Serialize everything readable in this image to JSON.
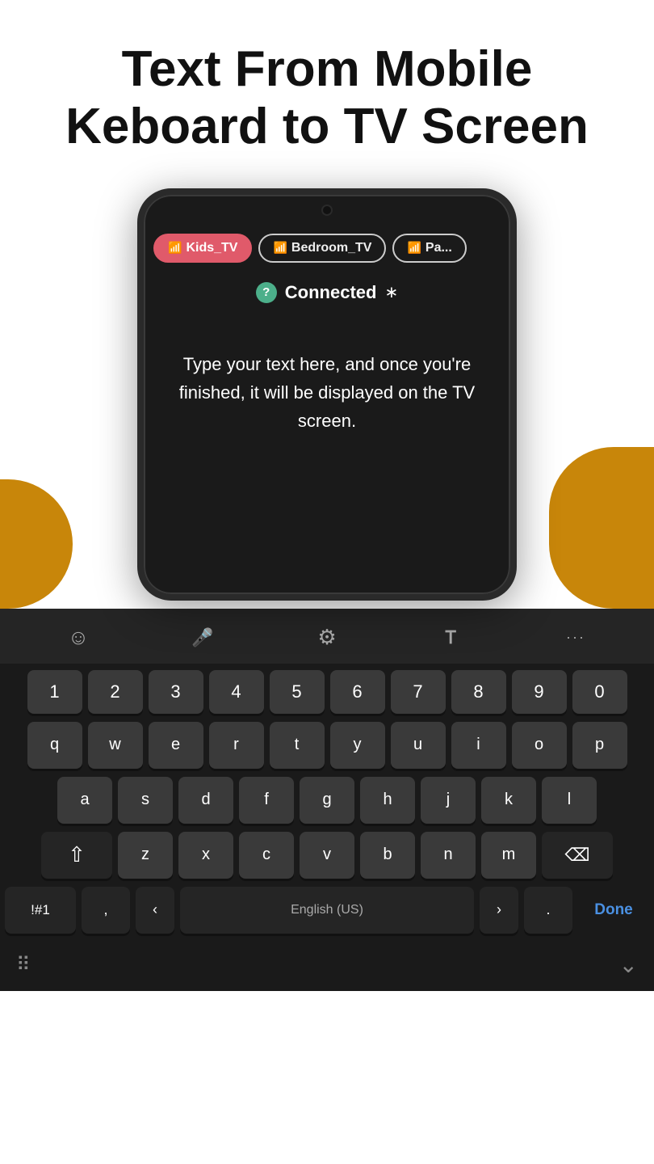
{
  "header": {
    "title": "Text From Mobile Keboard to TV Screen"
  },
  "phone": {
    "tabs": [
      {
        "label": "Kids_TV",
        "active": true
      },
      {
        "label": "Bedroom_TV",
        "active": false
      },
      {
        "label": "Pa...",
        "active": false
      }
    ],
    "status": {
      "connected_label": "Connected",
      "icon_label": "?"
    },
    "typing_placeholder": "Type your text here, and once you're finished, it will be displayed on the TV screen."
  },
  "keyboard": {
    "toolbar": {
      "emoji_icon": "☺",
      "mic_icon": "🎤",
      "settings_icon": "⚙",
      "font_icon": "Ꭲ",
      "more_icon": "···"
    },
    "rows": {
      "numbers": [
        "1",
        "2",
        "3",
        "4",
        "5",
        "6",
        "7",
        "8",
        "9",
        "0"
      ],
      "row1": [
        "q",
        "w",
        "e",
        "r",
        "t",
        "y",
        "u",
        "i",
        "o",
        "p"
      ],
      "row2": [
        "a",
        "s",
        "d",
        "f",
        "g",
        "h",
        "j",
        "k",
        "l"
      ],
      "row3": [
        "z",
        "x",
        "c",
        "v",
        "b",
        "n",
        "m"
      ],
      "bottom": {
        "symbols": "!#1",
        "comma": ",",
        "left_arrow": "‹",
        "space": "English (US)",
        "right_arrow": "›",
        "period": ".",
        "done": "Done"
      }
    },
    "bottom_bar": {
      "switcher_icon": "⠿",
      "hide_icon": "⌄"
    }
  }
}
